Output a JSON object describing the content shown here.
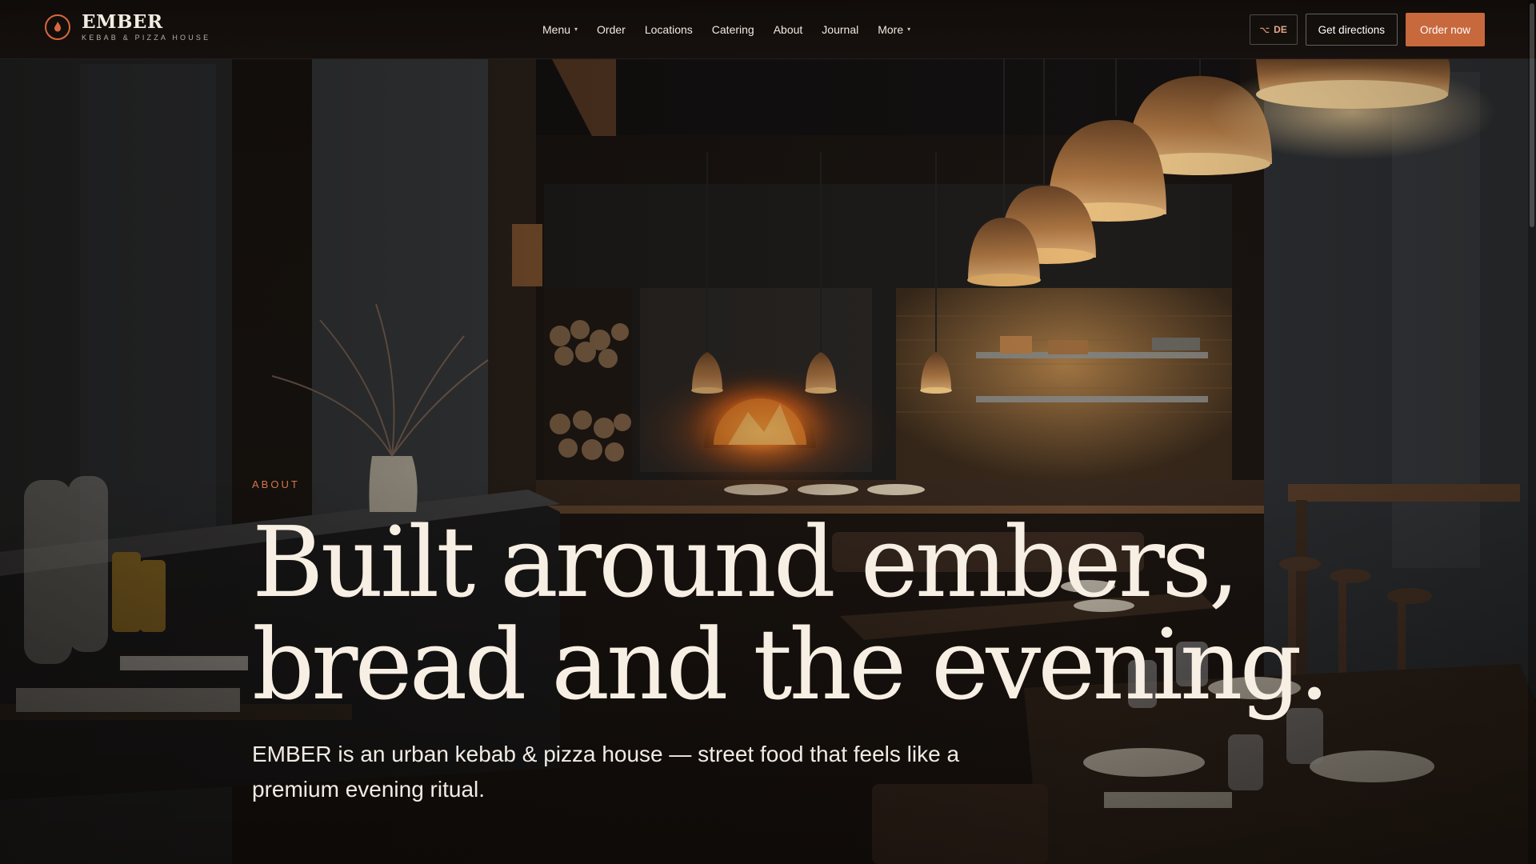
{
  "brand": {
    "name": "EMBER",
    "tagline": "KEBAB & PIZZA HOUSE",
    "icon": "flame-icon"
  },
  "nav": {
    "items": [
      {
        "label": "Menu",
        "dropdown": true
      },
      {
        "label": "Order",
        "dropdown": false
      },
      {
        "label": "Locations",
        "dropdown": false
      },
      {
        "label": "Catering",
        "dropdown": false
      },
      {
        "label": "About",
        "dropdown": false
      },
      {
        "label": "Journal",
        "dropdown": false
      },
      {
        "label": "More",
        "dropdown": true
      }
    ]
  },
  "header_actions": {
    "language_label": "DE",
    "language_icon": "translate-icon",
    "directions_label": "Get directions",
    "order_label": "Order now"
  },
  "hero": {
    "eyebrow": "ABOUT",
    "headline_line1": "Built around embers,",
    "headline_line2": "bread and the evening.",
    "lede": "EMBER is an urban kebab & pizza house — street food that feels like a premium evening ritual."
  },
  "colors": {
    "accent": "#c8683d",
    "eyebrow": "#d5774c",
    "headline": "#f7efe3",
    "background": "#16110d"
  }
}
